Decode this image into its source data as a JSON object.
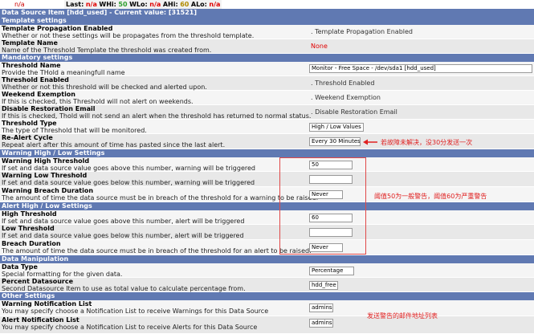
{
  "topbar": {
    "na_left": "n/a",
    "last_label": "Last:",
    "last_value": "n/a",
    "whi_label": "WHi:",
    "whi_value": "50",
    "wlo_label": "WLo:",
    "wlo_value": "n/a",
    "ahi_label": "AHi:",
    "ahi_value": "60",
    "alo_label": "ALo:",
    "alo_value": "n/a"
  },
  "header": {
    "title": "Data Source Item [hdd_used] - Current value: [31521]"
  },
  "sections": {
    "template": "Template settings",
    "mandatory": "Mandatory settings",
    "warning": "Warning High / Low Settings",
    "alert": "Alert High / Low Settings",
    "manipulation": "Data Manipulation",
    "other": "Other Settings"
  },
  "rows": {
    "template_propagation": {
      "title": "Template Propagation Enabled",
      "desc": "Whether or not these settings will be propagates from the threshold template.",
      "value": "Template Propagation Enabled"
    },
    "template_name": {
      "title": "Template Name",
      "desc": "Name of the Threshold Template the threshold was created from.",
      "value": "None"
    },
    "threshold_name": {
      "title": "Threshold Name",
      "desc": "Provide the THold a meaningfull name",
      "value": "Monitor - Free Space - /dev/sda1 [hdd_used]"
    },
    "threshold_enabled": {
      "title": "Threshold Enabled",
      "desc": "Whether or not this threshold will be checked and alerted upon.",
      "value": "Threshold Enabled"
    },
    "weekend_exemption": {
      "title": "Weekend Exemption",
      "desc": "If this is checked, this Threshold will not alert on weekends.",
      "value": "Weekend Exemption"
    },
    "disable_restoration": {
      "title": "Disable Restoration Email",
      "desc": "If this is checked, Thold will not send an alert when the threshold has returned to normal status.",
      "value": "Disable Restoration Email"
    },
    "threshold_type": {
      "title": "Threshold Type",
      "desc": "The type of Threshold that will be monitored.",
      "value": "High / Low Values"
    },
    "realert_cycle": {
      "title": "Re-Alert Cycle",
      "desc": "Repeat alert after this amount of time has pasted since the last alert.",
      "value": "Every 30 Minutes"
    },
    "warning_high": {
      "title": "Warning High Threshold",
      "desc": "If set and data source value goes above this number, warning will be triggered",
      "value": "50"
    },
    "warning_low": {
      "title": "Warning Low Threshold",
      "desc": "If set and data source value goes below this number, warning will be triggered",
      "value": ""
    },
    "warning_breach": {
      "title": "Warning Breach Duration",
      "desc": "The amount of time the data source must be in breach of the threshold for a warning to be raised.",
      "value": "Never"
    },
    "high_threshold": {
      "title": "High Threshold",
      "desc": "If set and data source value goes above this number, alert will be triggered",
      "value": "60"
    },
    "low_threshold": {
      "title": "Low Threshold",
      "desc": "If set and data source value goes below this number, alert will be triggered",
      "value": ""
    },
    "breach_duration": {
      "title": "Breach Duration",
      "desc": "The amount of time the data source must be in breach of the threshold for an alert to be raised.",
      "value": "Never"
    },
    "data_type": {
      "title": "Data Type",
      "desc": "Special formatting for the given data.",
      "value": "Percentage"
    },
    "percent_datasource": {
      "title": "Percent Datasource",
      "desc": "Second Datasource Item to use as total value to calculate percentage from.",
      "value": "hdd_free"
    },
    "warning_notification": {
      "title": "Warning Notification List",
      "desc": "You may specify choose a Notification List to receive Warnings for this Data Source",
      "value": "admins"
    },
    "alert_notification": {
      "title": "Alert Notification List",
      "desc": "You may specify choose a Notification List to receive Alerts for this Data Source",
      "value": "admins"
    }
  },
  "notes": {
    "realert": "若故障未解决，没30分发送一次",
    "thresholds": "阈值50为一般警告，阈值60为严重警告",
    "notify": "发送警告的邮件地址列表"
  },
  "colors": {
    "header_bg": "#6079b2",
    "annotation": "#e02020"
  }
}
